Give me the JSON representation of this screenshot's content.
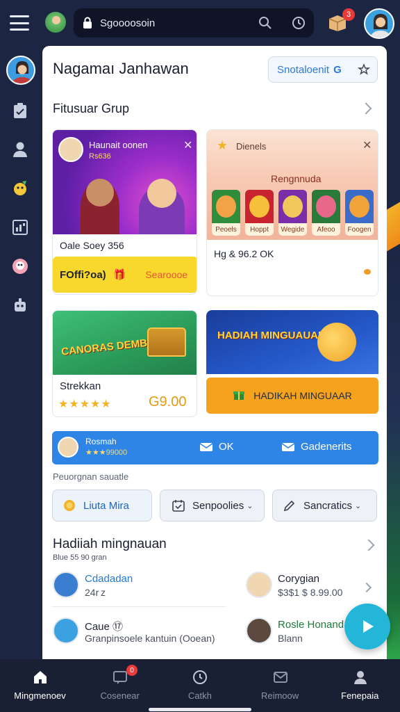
{
  "search": {
    "value": "Sgoooosoin"
  },
  "header": {
    "box_badge": "3"
  },
  "panel": {
    "title": "Nagamaı Janhawan",
    "sort_label": "Snotaloenit",
    "sort_suffix": "G"
  },
  "group": {
    "title": "Fitusuar Grup",
    "card1": {
      "art_title": "Haunait oonen",
      "art_sub": "Rs636",
      "caption": "Oale Soey 356",
      "cta_bold": "FOffi?oa)",
      "cta_label": "Searoooe"
    },
    "card2": {
      "label": "Dienels",
      "heading": "Rengnnuda",
      "tiles": [
        "Peoels",
        "Hoppt",
        "Wegide",
        "Afeoo",
        "Foogen"
      ],
      "amount": "Hg & 96.2 OK"
    },
    "card3": {
      "logo": "CANORAS DEMBAWAN",
      "caption": "Strekkan",
      "stars": "★★★★★",
      "price": "G9.00"
    },
    "card4": {
      "logo": "HADIAH MINGUAUAR",
      "button_label": "HADIKAH MINGUAAR"
    }
  },
  "banner": {
    "name": "Rosmah",
    "score": "★★★99000",
    "ok_label": "OK",
    "calendar_label": "Gadenerits"
  },
  "filters": {
    "label": "Peuorgnan sauatle",
    "items": [
      {
        "label": "Liuta Mira"
      },
      {
        "label": "Senpoolies"
      },
      {
        "label": "Sancratics"
      }
    ]
  },
  "weekly": {
    "title": "Hadiiah mingnauan",
    "subtitle": "Blue 55 90 gran",
    "items": [
      {
        "name": "Cdadadan",
        "meta": "24r z",
        "color": "#2478d0"
      },
      {
        "name": "Corygian",
        "meta": "$3$1 $  8.99.00",
        "color": "#1d2333"
      },
      {
        "name": "Caue ⑰",
        "meta": "Granpinsoele kantuin  (Ooean)",
        "color": "#1d2333"
      },
      {
        "name": "Rosle Honand",
        "meta": "Blann",
        "color": "#1f7a3a"
      }
    ]
  },
  "nav": {
    "badge": "0",
    "items": [
      {
        "label": "Mingmenoev"
      },
      {
        "label": "Cosenear"
      },
      {
        "label": "Catkh"
      },
      {
        "label": "Reimoow"
      },
      {
        "label": "Fenepaia"
      }
    ]
  },
  "colors": {
    "topbar": "#1c2541",
    "accent_blue": "#2f85e6",
    "accent_yellow": "#f8d82d",
    "accent_orange": "#f5a21c",
    "fab": "#23b6d8"
  }
}
